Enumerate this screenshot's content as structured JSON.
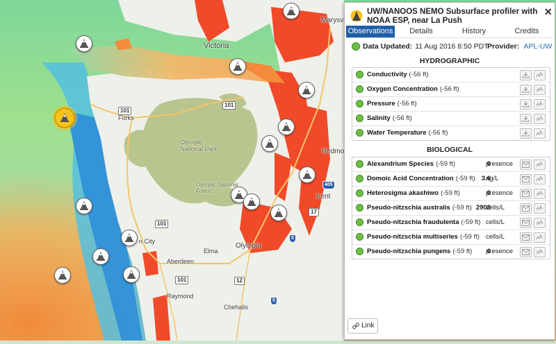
{
  "colors": {
    "accent": "#1f5ea8",
    "ok": "#6fbe45",
    "land": "#eef0ea",
    "mountains": "#b9c58e",
    "hot": "#f04a2a"
  },
  "map": {
    "labels": {
      "victoria": "Victoria",
      "marysville": "Marysville",
      "redmond": "Redmond",
      "kent": "Kent",
      "forks": "Forks",
      "olympia": "Olympia",
      "elma": "Elma",
      "aberdeen": "Aberdeen",
      "raymond": "Raymond",
      "chehalis": "Chehalis",
      "olympic_np": "Olympic National Park",
      "olympic_nf": "Olympic National Forest",
      "city_frag": "n City"
    },
    "shields": {
      "s101a": "101",
      "s101b": "101",
      "s101c": "101",
      "s12": "12",
      "s101d": "101",
      "s405": "405",
      "s5": "5",
      "s5b": "5",
      "s17": "17"
    }
  },
  "panel": {
    "title": "UW/NANOOS NEMO Subsurface profiler with NOAA ESP, near La Push",
    "close_icon": "×",
    "tabs": [
      "Observations",
      "Details",
      "History",
      "Credits"
    ],
    "updated_label": "Data Updated:",
    "updated_value": "11 Aug 2016 8:50 PDT",
    "provider_label": "Provider:",
    "provider_value": "APL-UW",
    "hydro_title": "HYDROGRAPHIC",
    "hydrographic": [
      {
        "name": "Conductivity",
        "depth": "(-56 ft)"
      },
      {
        "name": "Oxygen Concentration",
        "depth": "(-56 ft)"
      },
      {
        "name": "Pressure",
        "depth": "(-56 ft)"
      },
      {
        "name": "Salinity",
        "depth": "(-56 ft)"
      },
      {
        "name": "Water Temperature",
        "depth": "(-56 ft)"
      }
    ],
    "bio_title": "BIOLOGICAL",
    "biological": [
      {
        "name": "Alexandrium Species",
        "depth": "(-59 ft)",
        "value": "0",
        "unit": "presence"
      },
      {
        "name": "Domoic Acid Concentration",
        "depth": "(-59 ft)",
        "value": "3.6",
        "unit": "ng/L"
      },
      {
        "name": "Heterosigma akashiwo",
        "depth": "(-59 ft)",
        "value": "0",
        "unit": "presence"
      },
      {
        "name": "Pseudo-nitzschia australis",
        "depth": "(-59 ft)",
        "value": "2908",
        "unit": "cells/L"
      },
      {
        "name": "Pseudo-nitzschia fraudulenta",
        "depth": "(-59 ft)",
        "value": "",
        "unit": "cells/L"
      },
      {
        "name": "Pseudo-nitzschia multiseries",
        "depth": "(-59 ft)",
        "value": "",
        "unit": "cells/L"
      },
      {
        "name": "Pseudo-nitzschia pungens",
        "depth": "(-59 ft)",
        "value": "0",
        "unit": "presence"
      }
    ],
    "link_label": "Link"
  }
}
